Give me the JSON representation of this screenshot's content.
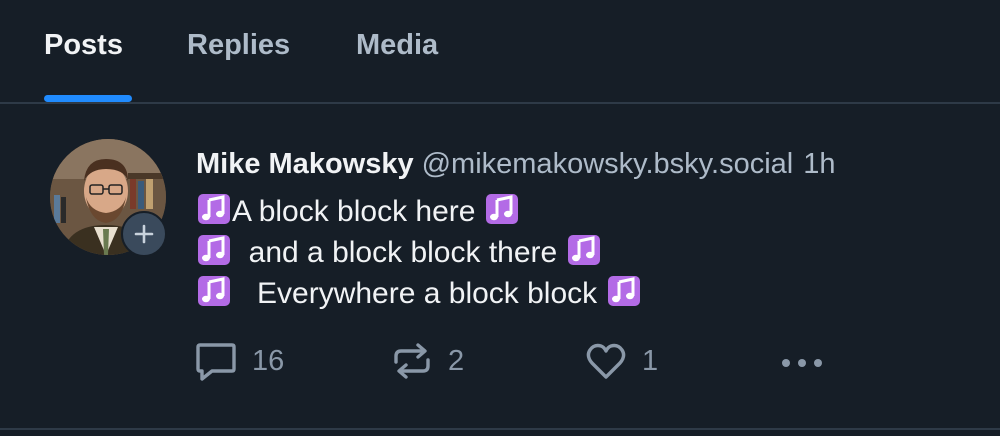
{
  "tabs": [
    {
      "label": "Posts",
      "active": true
    },
    {
      "label": "Replies",
      "active": false
    },
    {
      "label": "Media",
      "active": false
    }
  ],
  "colors": {
    "background": "#161e27",
    "accent": "#208bfe",
    "text_primary": "#f1f3f5",
    "text_secondary": "#aebbc9",
    "note_emoji": "#b36be6"
  },
  "post": {
    "author_name": "Mike Makowsky",
    "handle": "@mikemakowsky.bsky.social",
    "time": "1h",
    "lines": [
      "A block block here ",
      "  and a block block there ",
      "   Everywhere a block block "
    ],
    "emoji": "musical-notes",
    "reply_count": "16",
    "repost_count": "2",
    "like_count": "1"
  },
  "icons": {
    "follow": "plus-icon",
    "reply": "speech-bubble-icon",
    "repost": "repost-arrows-icon",
    "like": "heart-icon",
    "more": "ellipsis-icon"
  }
}
